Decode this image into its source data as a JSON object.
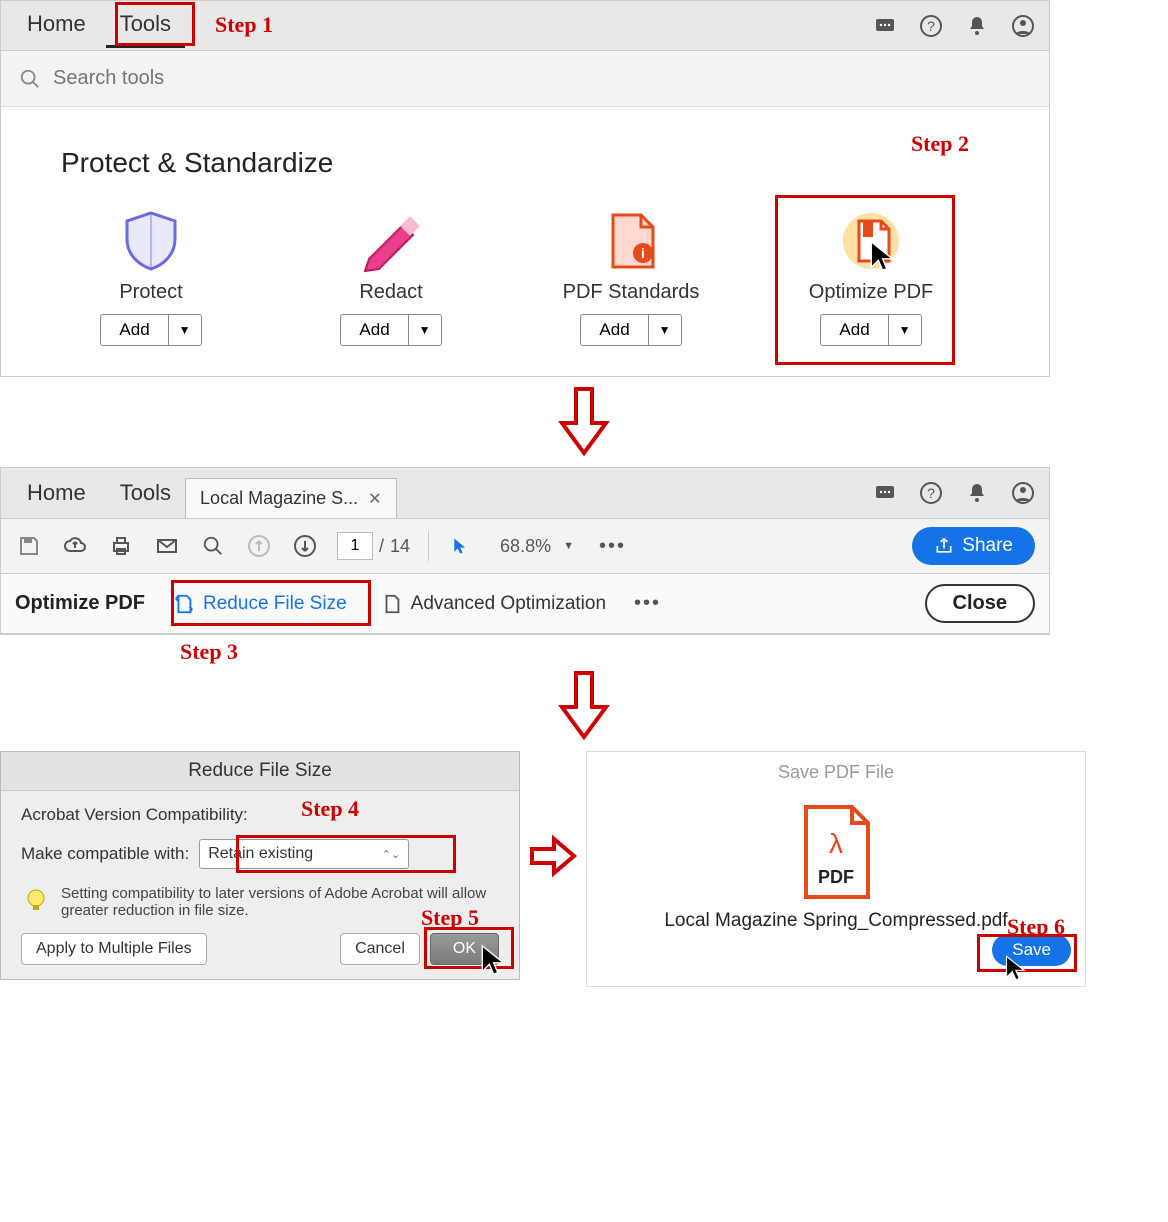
{
  "steps": {
    "s1": "Step 1",
    "s2": "Step 2",
    "s3": "Step 3",
    "s4": "Step 4",
    "s5": "Step 5",
    "s6": "Step 6"
  },
  "panel1": {
    "nav": {
      "home": "Home",
      "tools": "Tools"
    },
    "search_placeholder": "Search tools",
    "section_title": "Protect & Standardize",
    "tools": {
      "protect": "Protect",
      "redact": "Redact",
      "standards": "PDF Standards",
      "optimize": "Optimize PDF"
    },
    "add_label": "Add"
  },
  "panel2": {
    "nav": {
      "home": "Home",
      "tools": "Tools"
    },
    "tab_title": "Local Magazine S...",
    "page_current": "1",
    "page_total": "14",
    "zoom": "68.8%",
    "share": "Share",
    "subbar": {
      "title": "Optimize PDF",
      "reduce": "Reduce File Size",
      "advanced": "Advanced Optimization",
      "close": "Close"
    }
  },
  "panel3": {
    "title": "Reduce File Size",
    "compat_label": "Acrobat Version Compatibility:",
    "make_label": "Make compatible with:",
    "select_value": "Retain existing",
    "tip": "Setting compatibility to later versions of Adobe Acrobat will allow greater reduction in file size.",
    "apply": "Apply to Multiple Files",
    "cancel": "Cancel",
    "ok": "OK"
  },
  "panel4": {
    "title": "Save PDF File",
    "pdf_label": "PDF",
    "filename": "Local Magazine Spring_Compressed.pdf",
    "save": "Save"
  }
}
